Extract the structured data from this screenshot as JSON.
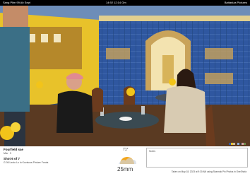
{
  "status_bar": {
    "left": "Sang Plim 99 Ab Sept",
    "center": "14:92 12:14 Gm",
    "right": "Battaniza Pictures"
  },
  "info": {
    "location_title": "Fourfield sae",
    "location_sub": "Mia · 3",
    "shot_title": "Shot 6 of 7",
    "shot_sub": "G 06 Lecto Lo lo Kuviscus Pinture Fonds",
    "weather_temp": "71°",
    "weather_precip": "25mm",
    "notes_label": "Notes",
    "timestamp": "Taken on May 18, 2023 at 9:30 AM using Shannok Pin Photos in OneShofa"
  },
  "colors": {
    "tile_blue": "#2f57a0",
    "wall_yellow": "#e8c22a",
    "swatches": [
      "#2f57a0",
      "#e8c22a",
      "#c9b59a",
      "#5a3a22",
      "#8fb0d8",
      "#3a3a3a",
      "#d7a0a0",
      "#6e8a4a"
    ]
  }
}
